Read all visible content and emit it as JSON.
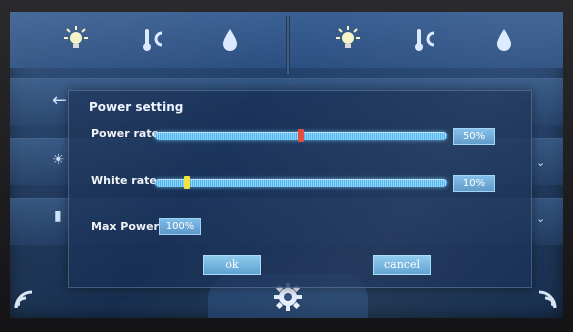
{
  "colors": {
    "accent": "#4fb2ec",
    "power_thumb": "#e24a3a",
    "white_thumb": "#f2e23a"
  },
  "topbar": {
    "icons": [
      "light-icon",
      "temperature-icon",
      "water-drop-icon",
      "light-icon",
      "temperature-icon",
      "water-drop-icon"
    ]
  },
  "dialog": {
    "title": "Power setting",
    "power_rate": {
      "label": "Power rate",
      "value": "50%",
      "level": 0.5
    },
    "white_rate": {
      "label": "White rate",
      "value": "10%",
      "level": 0.1
    },
    "max_power": {
      "label": "Max Power",
      "value": "100%"
    },
    "ok_label": "ok",
    "cancel_label": "cancel"
  },
  "bottom": {
    "icons": [
      "wifi-icon",
      "settings-gear-icon",
      "wifi-icon"
    ]
  }
}
